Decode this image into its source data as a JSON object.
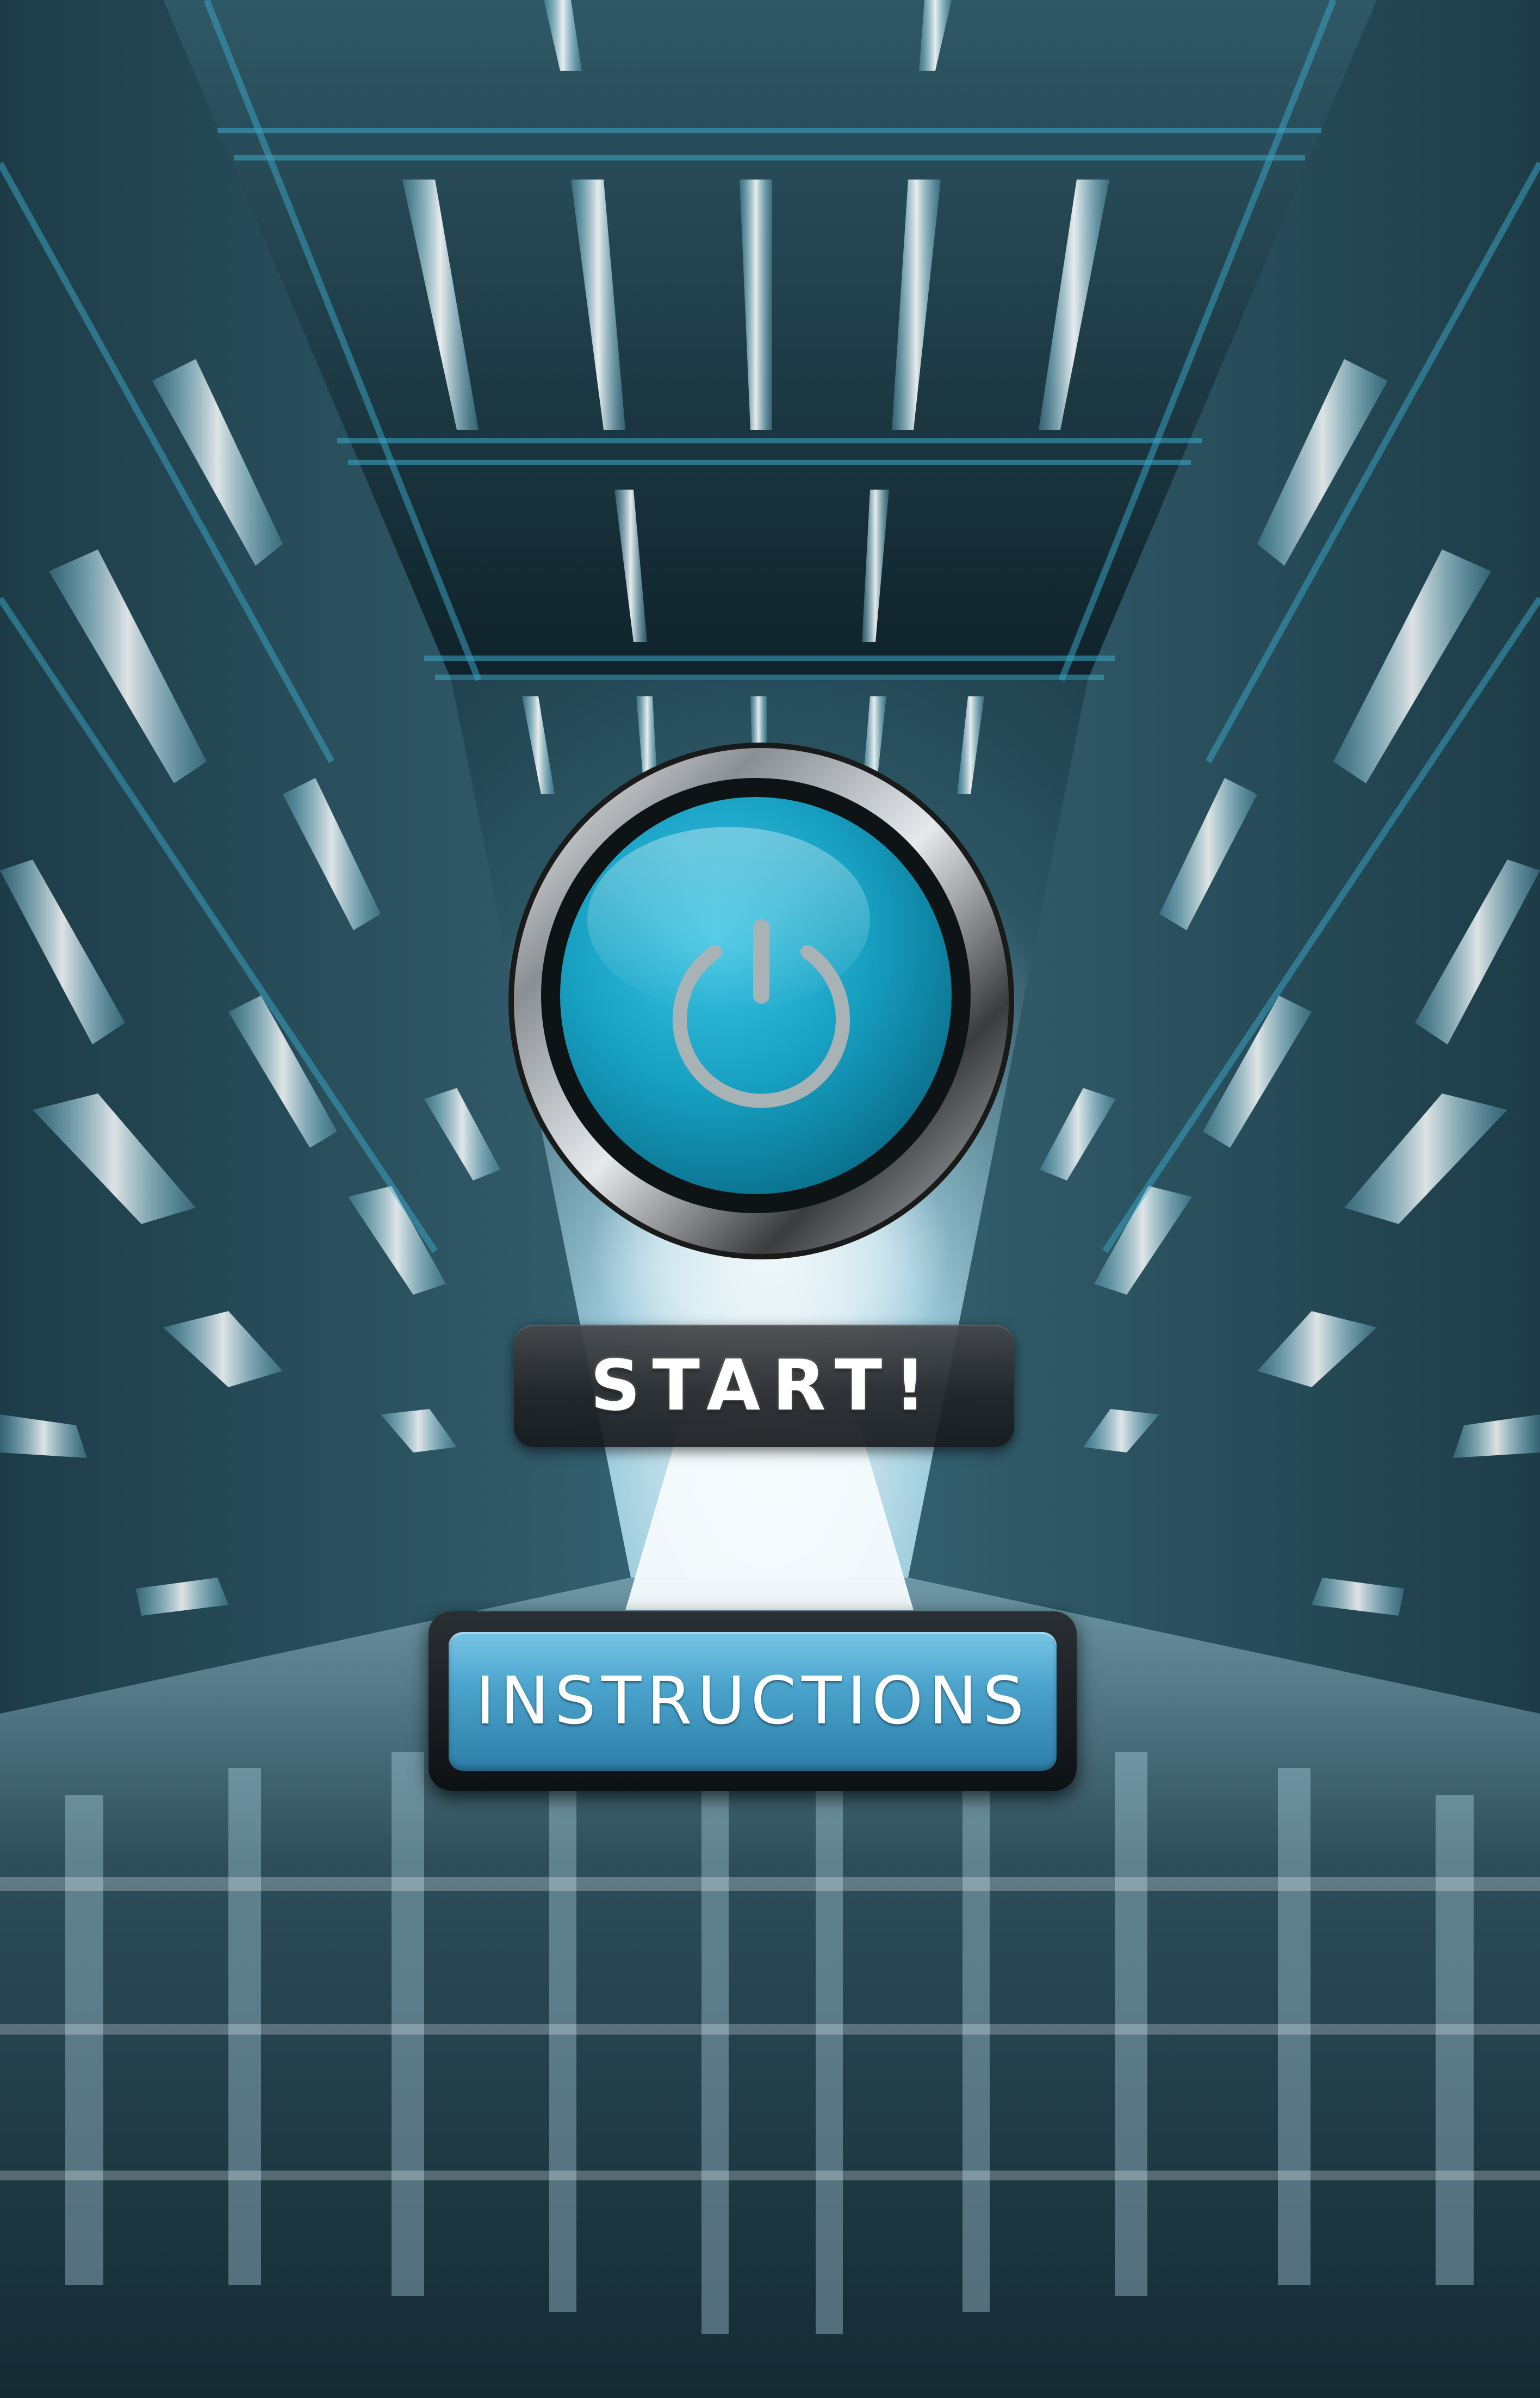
{
  "menu": {
    "start_label": "START!",
    "instructions_label": "INSTRUCTIONS"
  },
  "icons": {
    "power": "power-icon"
  },
  "colors": {
    "accent_blue": "#1aa6c8",
    "button_blue": "#4aa3cc",
    "corridor_light": "#cfeffa",
    "corridor_dark": "#0d2129"
  }
}
